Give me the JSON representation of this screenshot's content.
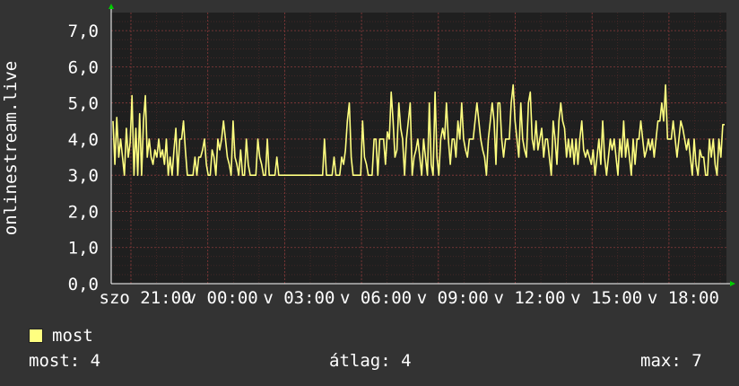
{
  "chart_data": {
    "type": "line",
    "ylabel": "onlinestream.live",
    "ylim": [
      0,
      7.5
    ],
    "y_ticks": [
      "0,0",
      "1,0",
      "2,0",
      "3,0",
      "4,0",
      "5,0",
      "6,0",
      "7,0"
    ],
    "x_ticks": [
      "szo 21:00",
      "v 00:00",
      "v 03:00",
      "v 06:00",
      "v 09:00",
      "v 12:00",
      "v 15:00",
      "v 18:00"
    ],
    "grid": true,
    "series": [
      {
        "name": "most",
        "color": "#ffff80",
        "values": [
          4.5,
          3.3,
          4.6,
          3.5,
          4.0,
          3.5,
          3.0,
          4.3,
          3.5,
          3.9,
          5.2,
          3.0,
          4.3,
          3.0,
          4.7,
          3.0,
          4.5,
          5.2,
          3.5,
          4.0,
          3.5,
          3.3,
          3.7,
          3.5,
          4.0,
          3.5,
          3.7,
          3.3,
          4.0,
          3.0,
          3.5,
          3.0,
          3.7,
          4.3,
          3.0,
          4.0,
          4.0,
          4.5,
          3.7,
          3.0,
          3.0,
          3.0,
          3.0,
          3.5,
          3.0,
          3.5,
          3.5,
          3.7,
          4.0,
          3.3,
          3.0,
          3.0,
          3.7,
          3.5,
          3.0,
          4.0,
          3.7,
          4.0,
          4.5,
          4.0,
          3.5,
          3.3,
          3.0,
          4.5,
          3.5,
          3.3,
          3.0,
          3.7,
          3.0,
          3.0,
          4.0,
          3.3,
          3.0,
          3.0,
          3.0,
          3.0,
          4.0,
          3.5,
          3.3,
          3.0,
          3.0,
          4.0,
          3.0,
          3.0,
          3.0,
          3.0,
          3.5,
          3.0,
          3.0,
          3.0,
          3.0,
          3.0,
          3.0,
          3.0,
          3.0,
          3.0,
          3.0,
          3.0,
          3.0,
          3.0,
          3.0,
          3.0,
          3.0,
          3.0,
          3.0,
          3.0,
          3.0,
          3.0,
          3.0,
          3.0,
          3.0,
          4.0,
          3.0,
          3.0,
          3.0,
          3.0,
          3.5,
          3.0,
          3.0,
          3.0,
          3.5,
          3.3,
          3.7,
          4.5,
          5.0,
          3.5,
          3.0,
          3.0,
          3.0,
          3.0,
          3.0,
          4.5,
          3.5,
          3.3,
          3.0,
          3.0,
          3.0,
          4.0,
          4.0,
          3.0,
          4.0,
          4.0,
          4.0,
          3.3,
          4.2,
          4.0,
          5.3,
          4.5,
          3.5,
          3.7,
          5.0,
          4.3,
          4.0,
          3.0,
          4.0,
          4.5,
          5.0,
          3.0,
          3.5,
          3.7,
          4.0,
          3.5,
          3.0,
          4.0,
          3.5,
          3.0,
          5.0,
          3.3,
          3.0,
          5.3,
          3.5,
          3.0,
          4.0,
          4.3,
          4.0,
          5.0,
          4.0,
          3.3,
          4.0,
          4.0,
          3.5,
          4.5,
          4.0,
          5.0,
          4.0,
          3.7,
          3.5,
          4.0,
          4.0,
          4.0,
          4.5,
          5.0,
          4.5,
          4.0,
          3.7,
          3.5,
          3.0,
          4.0,
          4.5,
          5.0,
          4.5,
          3.3,
          5.0,
          5.0,
          4.0,
          3.5,
          4.0,
          4.0,
          4.0,
          5.0,
          5.5,
          4.5,
          4.0,
          3.5,
          5.0,
          4.0,
          3.7,
          3.5,
          5.0,
          5.3,
          4.0,
          3.7,
          4.5,
          3.7,
          4.0,
          4.3,
          3.5,
          4.0,
          4.0,
          3.5,
          3.0,
          4.5,
          4.0,
          3.3,
          4.5,
          5.0,
          4.5,
          4.3,
          3.5,
          4.0,
          3.5,
          4.0,
          3.3,
          4.0,
          3.3,
          4.0,
          4.5,
          3.7,
          3.5,
          3.7,
          3.5,
          3.3,
          3.7,
          3.0,
          3.5,
          4.0,
          3.3,
          4.5,
          3.5,
          3.0,
          3.5,
          4.0,
          3.7,
          4.0,
          3.5,
          3.0,
          4.0,
          3.5,
          4.5,
          3.5,
          4.0,
          3.5,
          3.0,
          4.0,
          3.3,
          4.0,
          4.0,
          4.5,
          4.0,
          3.5,
          3.7,
          4.0,
          3.7,
          4.0,
          3.5,
          4.0,
          4.5,
          4.5,
          5.0,
          4.5,
          5.5,
          4.0,
          4.0,
          4.0,
          4.5,
          4.0,
          3.5,
          4.0,
          4.5,
          4.3,
          4.0,
          3.7,
          4.0,
          3.5,
          3.0,
          4.0,
          3.3,
          3.0,
          3.7,
          3.5,
          3.5,
          3.0,
          3.0,
          4.0,
          3.5,
          4.0,
          3.3,
          3.0,
          4.0,
          3.5,
          4.4,
          4.4
        ]
      }
    ]
  },
  "legend": {
    "label": "most",
    "color": "#ffff80"
  },
  "stats": {
    "current": "most: 4",
    "average": "átlag: 4",
    "maximum": "max: 7"
  }
}
